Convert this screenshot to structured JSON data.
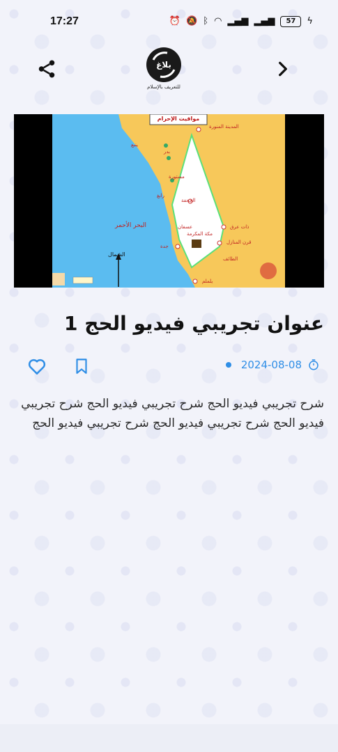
{
  "status_bar": {
    "time": "17:27",
    "battery": "57",
    "icons": [
      "alarm-icon",
      "mute-icon",
      "bluetooth-icon",
      "wifi-icon",
      "signal-icon",
      "signal-icon",
      "battery-icon",
      "charging-icon"
    ]
  },
  "header": {
    "logo_text": "بلاغ",
    "logo_caption": "للتعريف بالإسلام"
  },
  "video": {
    "map_title": "مواقيت الإحرام",
    "north_label": "الشمال",
    "sea_label": "البحر الأحمر",
    "places": [
      "المدينة المنورة",
      "ينبع",
      "بدر",
      "مستورة",
      "رابغ",
      "الجحفة",
      "عسفان",
      "مكة المكرمة",
      "جدة",
      "ذات عرق",
      "قرن المنازل",
      "الطائف",
      "يلملم"
    ]
  },
  "article": {
    "title": "عنوان تجريبي فيديو الحج 1",
    "date": "2024-08-08",
    "description": "شرح تجريبي فيديو الحج شرح تجريبي فيديو الحج شرح تجريبي فيديو الحج شرح تجريبي فيديو الحج شرح تجريبي فيديو الحج"
  },
  "colors": {
    "accent": "#2f8ee6",
    "background": "#f2f3fa",
    "sea": "#5bbcf0",
    "land": "#f7c85a"
  }
}
